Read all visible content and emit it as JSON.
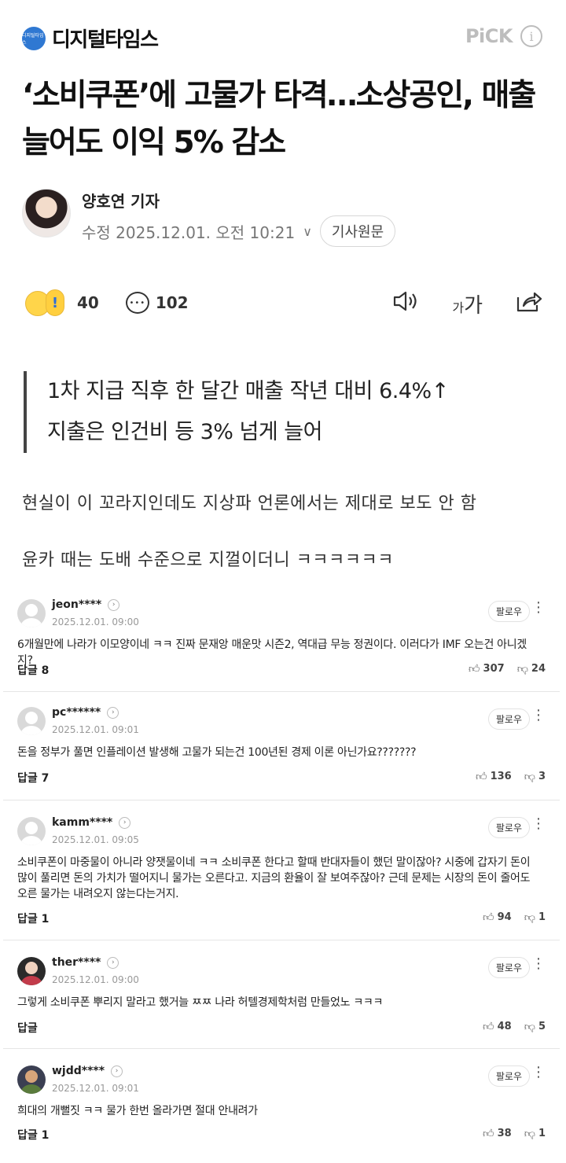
{
  "header": {
    "brand_logo_text": "디지털타임스",
    "brand_name": "디지털타임스",
    "pick_label": "PiCK",
    "info_icon": "i"
  },
  "article": {
    "headline": "‘소비쿠폰’에 고물가 타격…소상공인, 매출 늘어도 이익 5% 감소",
    "author": "양호연 기자",
    "date": "수정 2025.12.01. 오전 10:21",
    "original_button": "기사원문",
    "reaction_count": "40",
    "comment_count": "102",
    "font_tool_small": "가",
    "font_tool_large": "가",
    "subheads": [
      "1차 지급 직후 한 달간 매출 작년 대비 6.4%↑",
      "지출은 인건비 등 3% 넘게 늘어"
    ],
    "body_lines": [
      "현실이 이 꼬라지인데도 지상파 언론에서는 제대로 보도 안 함",
      "윤카 때는 도배 수준으로 지껄이더니 ㅋㅋㅋㅋㅋㅋ"
    ]
  },
  "comments": [
    {
      "user": "jeon****",
      "date": "2025.12.01. 09:00",
      "follow": "팔로우",
      "text": "6개월만에 나라가 이모양이네 ㅋㅋ 진짜 문재앙 매운맛 시즌2, 역대급 무능 정권이다. 이러다가 IMF 오는건 아니겠지?",
      "reply": "답글 8",
      "likes": "307",
      "dislikes": "24"
    },
    {
      "user": "pc******",
      "date": "2025.12.01. 09:01",
      "follow": "팔로우",
      "text": "돈을 정부가 풀면 인플레이션 발생해 고물가 되는건 100년된 경제 이론 아닌가요???????",
      "reply": "답글 7",
      "likes": "136",
      "dislikes": "3"
    },
    {
      "user": "kamm****",
      "date": "2025.12.01. 09:05",
      "follow": "팔로우",
      "text": "소비쿠폰이 마중물이 아니라 양잿물이네 ㅋㅋ 소비쿠폰 한다고 할때 반대자들이 했던 말이잖아? 시중에 갑자기 돈이 많이 풀리면 돈의 가치가 떨어지니 물가는 오른다고. 지금의 환율이 잘 보여주잖아? 근데 문제는 시장의 돈이 줄어도 오른 물가는 내려오지 않는다는거지.",
      "reply": "답글 1",
      "likes": "94",
      "dislikes": "1"
    },
    {
      "user": "ther****",
      "date": "2025.12.01. 09:00",
      "follow": "팔로우",
      "text": "그렇게 소비쿠폰 뿌리지 말라고 했거늘 ㅉㅉ 나라 허텔경제학처럼 만들었노 ㅋㅋㅋ",
      "reply": "답글",
      "likes": "48",
      "dislikes": "5"
    },
    {
      "user": "wjdd****",
      "date": "2025.12.01. 09:01",
      "follow": "팔로우",
      "text": "희대의 개뻘짓 ㅋㅋ 물가 한번 올라가면 절대 안내려가",
      "reply": "답글 1",
      "likes": "38",
      "dislikes": "1"
    }
  ]
}
